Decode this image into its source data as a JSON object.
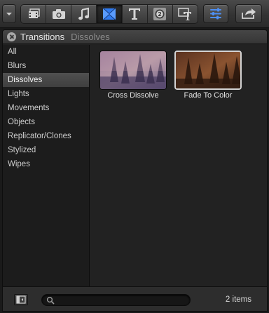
{
  "toolbar": {
    "buttons": [
      {
        "icon": "chevron-down-icon"
      },
      {
        "icon": "clapper-icon"
      },
      {
        "icon": "camera-icon"
      },
      {
        "icon": "music-note-icon"
      },
      {
        "icon": "transitions-icon",
        "active": true
      },
      {
        "icon": "title-t-icon"
      },
      {
        "icon": "generator-icon"
      },
      {
        "icon": "themes-icon"
      },
      {
        "icon": "inspector-icon"
      },
      {
        "icon": "share-icon"
      }
    ]
  },
  "browser": {
    "title": "Transitions",
    "subtitle": "Dissolves",
    "categories": [
      {
        "label": "All"
      },
      {
        "label": "Blurs"
      },
      {
        "label": "Dissolves",
        "selected": true
      },
      {
        "label": "Lights"
      },
      {
        "label": "Movements"
      },
      {
        "label": "Objects"
      },
      {
        "label": "Replicator/Clones"
      },
      {
        "label": "Stylized"
      },
      {
        "label": "Wipes"
      }
    ],
    "items": [
      {
        "label": "Cross Dissolve",
        "selected": false
      },
      {
        "label": "Fade To Color",
        "selected": true
      }
    ],
    "search": {
      "value": "",
      "placeholder": ""
    },
    "count": "2 items"
  },
  "colors": {
    "accent_blue": "#2f7bf0"
  }
}
